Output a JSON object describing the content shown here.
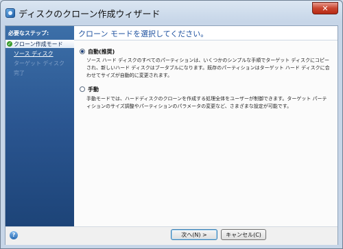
{
  "window": {
    "title": "ディスクのクローン作成ウィザード",
    "close_glyph": "✕"
  },
  "sidebar": {
    "header": "必要なステップ:",
    "steps": [
      {
        "label": "クローン作成モード",
        "state": "active"
      },
      {
        "label": "ソース ディスク",
        "state": "link"
      },
      {
        "label": "ターゲット ディスク",
        "state": "disabled"
      },
      {
        "label": "完了",
        "state": "disabled"
      }
    ]
  },
  "main": {
    "title": "クローン モードを選択してください。",
    "options": [
      {
        "label": "自動(推奨)",
        "selected": true,
        "description": "ソース ハード ディスクのすべてのパーティションは、いくつかのシンプルな手順でターゲット ディスクにコピーされ、新しいハード ディスクはブータブルになります。既存のパーティションはターゲット ハード ディスクに合わせてサイズが自動的に変更されます。"
      },
      {
        "label": "手動",
        "selected": false,
        "description": "手動モードでは、ハードディスクのクローンを作成する処理全体をユーザーが制御できます。ターゲット パーティションのサイズ調整やパーティションのパラメータの変更など、さまざまな設定が可能です。"
      }
    ]
  },
  "footer": {
    "next_label": "次へ(N) >",
    "cancel_label": "キャンセル(C)",
    "help_glyph": "?"
  },
  "colors": {
    "sidebar": "#2a5590",
    "title_accent": "#1b4f9e"
  }
}
